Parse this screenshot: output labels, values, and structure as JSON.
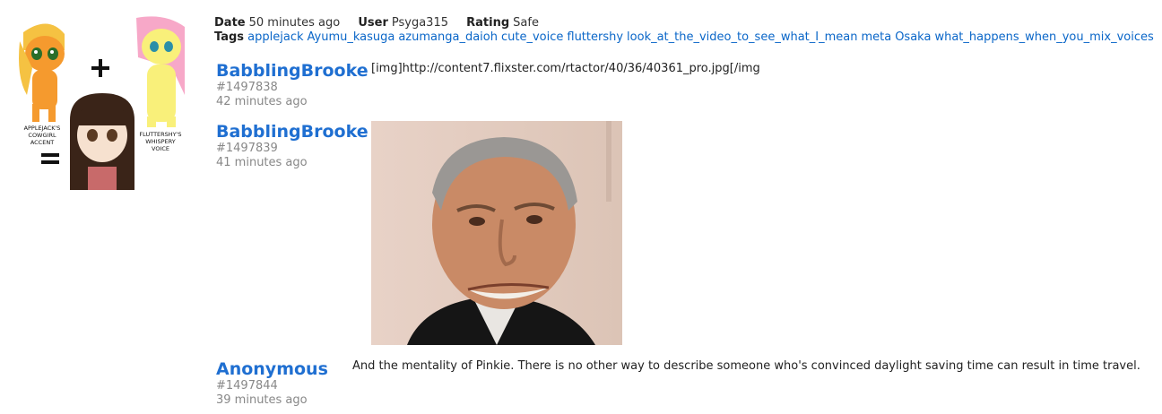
{
  "post": {
    "date_label": "Date",
    "date_value": "50 minutes ago",
    "user_label": "User",
    "user_value": "Psyga315",
    "rating_label": "Rating",
    "rating_value": "Safe",
    "tags_label": "Tags",
    "tags": [
      "applejack",
      "Ayumu_kasuga",
      "azumanga_daioh",
      "cute_voice",
      "fluttershy",
      "look_at_the_video_to_see_what_I_mean",
      "meta",
      "Osaka",
      "what_happens_when_you_mix_voices"
    ],
    "thumb_captions": {
      "left": [
        "APPLEJACK'S",
        "COWGIRL",
        "ACCENT"
      ],
      "right": [
        "FLUTTERSHY'S",
        "WHISPERY",
        "VOICE"
      ]
    }
  },
  "comments": [
    {
      "author": "BabblingBrooke",
      "number": "#1497838",
      "time": "42 minutes ago",
      "text": "[img]http://content7.flixster.com/rtactor/40/36/40361_pro.jpg[/img"
    },
    {
      "author": "BabblingBrooke",
      "number": "#1497839",
      "time": "41 minutes ago"
    },
    {
      "author": "Anonymous",
      "number": "#1497844",
      "time": "39 minutes ago",
      "text": "And the mentality of Pinkie. There is no other way to describe someone who's convinced daylight saving time can result in time travel."
    }
  ]
}
